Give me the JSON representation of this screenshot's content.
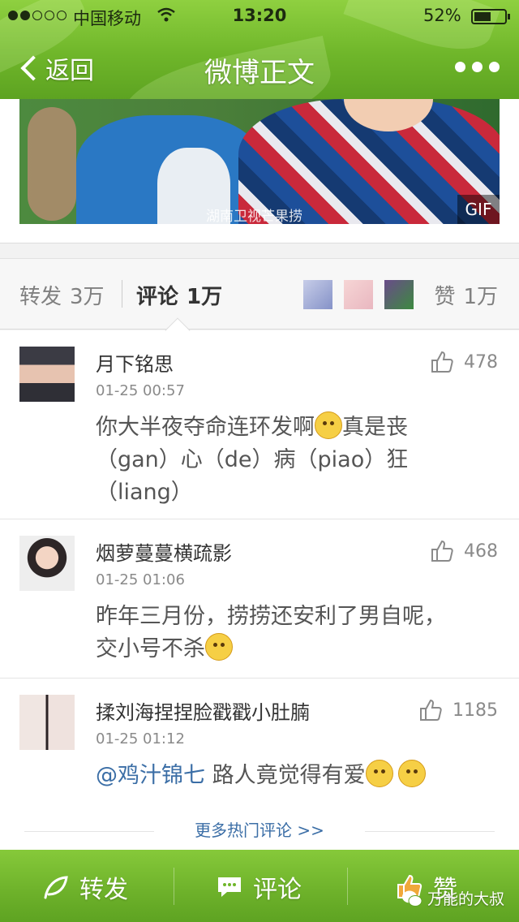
{
  "status_bar": {
    "carrier": "中国移动",
    "time": "13:20",
    "battery": "52%",
    "battery_level": 0.52,
    "signal_bars": 2
  },
  "nav": {
    "back_label": "返回",
    "title": "微博正文",
    "more_icon": "more-dots-icon"
  },
  "media": {
    "watermark": "湖南卫视芒果捞",
    "badge": "GIF"
  },
  "tabs": {
    "repost_label": "转发",
    "repost_count": "3万",
    "comment_label": "评论",
    "comment_count": "1万",
    "like_label": "赞",
    "like_count": "1万"
  },
  "comments": [
    {
      "user": "月下铭思",
      "time": "01-25 00:57",
      "likes": "478",
      "text_lines": [
        "你大半夜夺命连环发啊",
        "真是丧",
        "（gan）心（de）病（piao）狂",
        "（liang）"
      ]
    },
    {
      "user": "烟萝蔓蔓横疏影",
      "time": "01-25 01:06",
      "likes": "468",
      "text_lines": [
        "昨年三月份，捞捞还安利了男自呢，",
        "交小号不杀"
      ]
    },
    {
      "user": "揉刘海捏捏脸戳戳小肚腩",
      "time": "01-25 01:12",
      "likes": "1185",
      "mention": "@鸡汁锦七",
      "text": " 路人竟觉得有爱"
    }
  ],
  "more_comments": "更多热门评论 >>",
  "bottom_bar": {
    "repost": "转发",
    "comment": "评论",
    "like": "赞",
    "watermark": "万能的大叔"
  },
  "colors": {
    "green": "#6fb62a",
    "link": "#3b6ea6"
  }
}
